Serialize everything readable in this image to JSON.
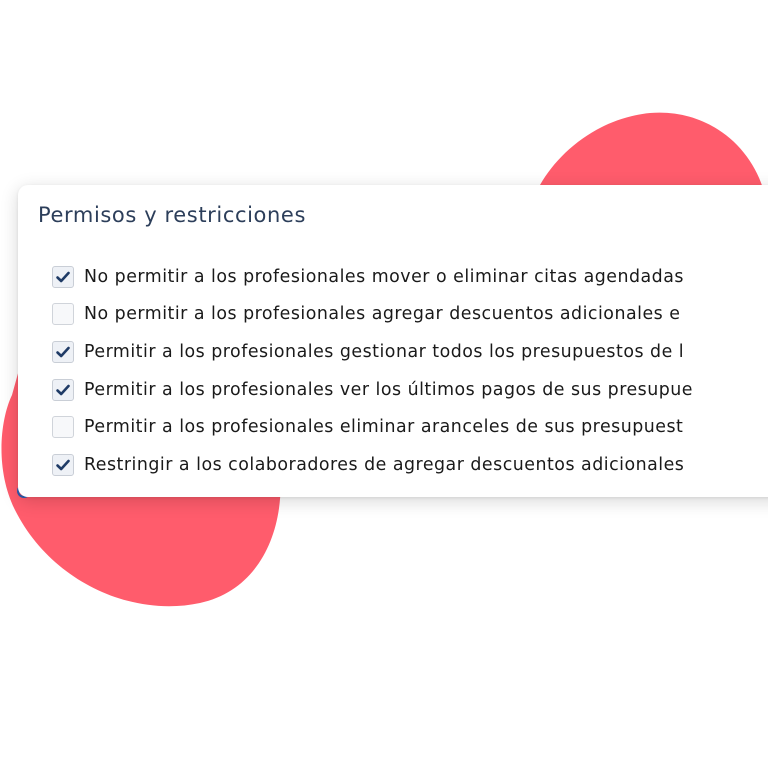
{
  "colors": {
    "accent_blob": "#ff5c6c",
    "title_text": "#2c3e5a",
    "check_mark": "#1f3b66"
  },
  "panel": {
    "title": "Permisos y restricciones",
    "options": [
      {
        "label": "No permitir a los profesionales mover o eliminar citas agendadas",
        "checked": true
      },
      {
        "label": "No permitir a los profesionales agregar descuentos adicionales e",
        "checked": false
      },
      {
        "label": "Permitir a los profesionales gestionar todos los presupuestos de l",
        "checked": true
      },
      {
        "label": "Permitir a los profesionales ver los últimos pagos de sus presupue",
        "checked": true
      },
      {
        "label": "Permitir a los profesionales eliminar aranceles de sus presupuest",
        "checked": false
      },
      {
        "label": "Restringir a los colaboradores de agregar descuentos adicionales",
        "checked": true
      }
    ]
  }
}
